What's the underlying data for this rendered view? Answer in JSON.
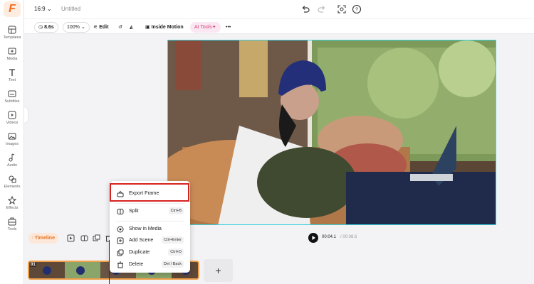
{
  "sidebar": {
    "items": [
      {
        "label": "Templates",
        "icon": "templates-icon"
      },
      {
        "label": "Media",
        "icon": "media-icon"
      },
      {
        "label": "Text",
        "icon": "text-icon"
      },
      {
        "label": "Subtitles",
        "icon": "subtitles-icon"
      },
      {
        "label": "Videos",
        "icon": "videos-icon"
      },
      {
        "label": "Images",
        "icon": "images-icon"
      },
      {
        "label": "Audio",
        "icon": "audio-icon"
      },
      {
        "label": "Elements",
        "icon": "elements-icon"
      },
      {
        "label": "Effects",
        "icon": "effects-icon"
      },
      {
        "label": "Tools",
        "icon": "tools-icon"
      }
    ]
  },
  "topbar": {
    "aspect_ratio": "16:9",
    "title": "Untitled"
  },
  "toolbar": {
    "duration": "8.6s",
    "zoom": "100%",
    "edit": "Edit",
    "inside_motion": "Inside Motion",
    "ai_tools": "AI Tools"
  },
  "timeline": {
    "label": "Timeline",
    "current_time": "00:04.1",
    "total_time": "/ 00:08.6",
    "scene_number": "01",
    "add_scene": "+"
  },
  "context_menu": {
    "items": [
      {
        "label": "Export Frame",
        "shortcut": ""
      },
      {
        "label": "Split",
        "shortcut": "Ctrl+B"
      },
      {
        "label": "Show in Media",
        "shortcut": ""
      },
      {
        "label": "Add Scene",
        "shortcut": "Ctrl+Enter"
      },
      {
        "label": "Duplicate",
        "shortcut": "Ctrl+D"
      },
      {
        "label": "Delete",
        "shortcut": "Del / Back"
      }
    ]
  },
  "colors": {
    "accent": "#f26b1d",
    "canvas_border": "#39d0e0",
    "highlight": "#d6231f",
    "track_border": "#f0a04b"
  }
}
